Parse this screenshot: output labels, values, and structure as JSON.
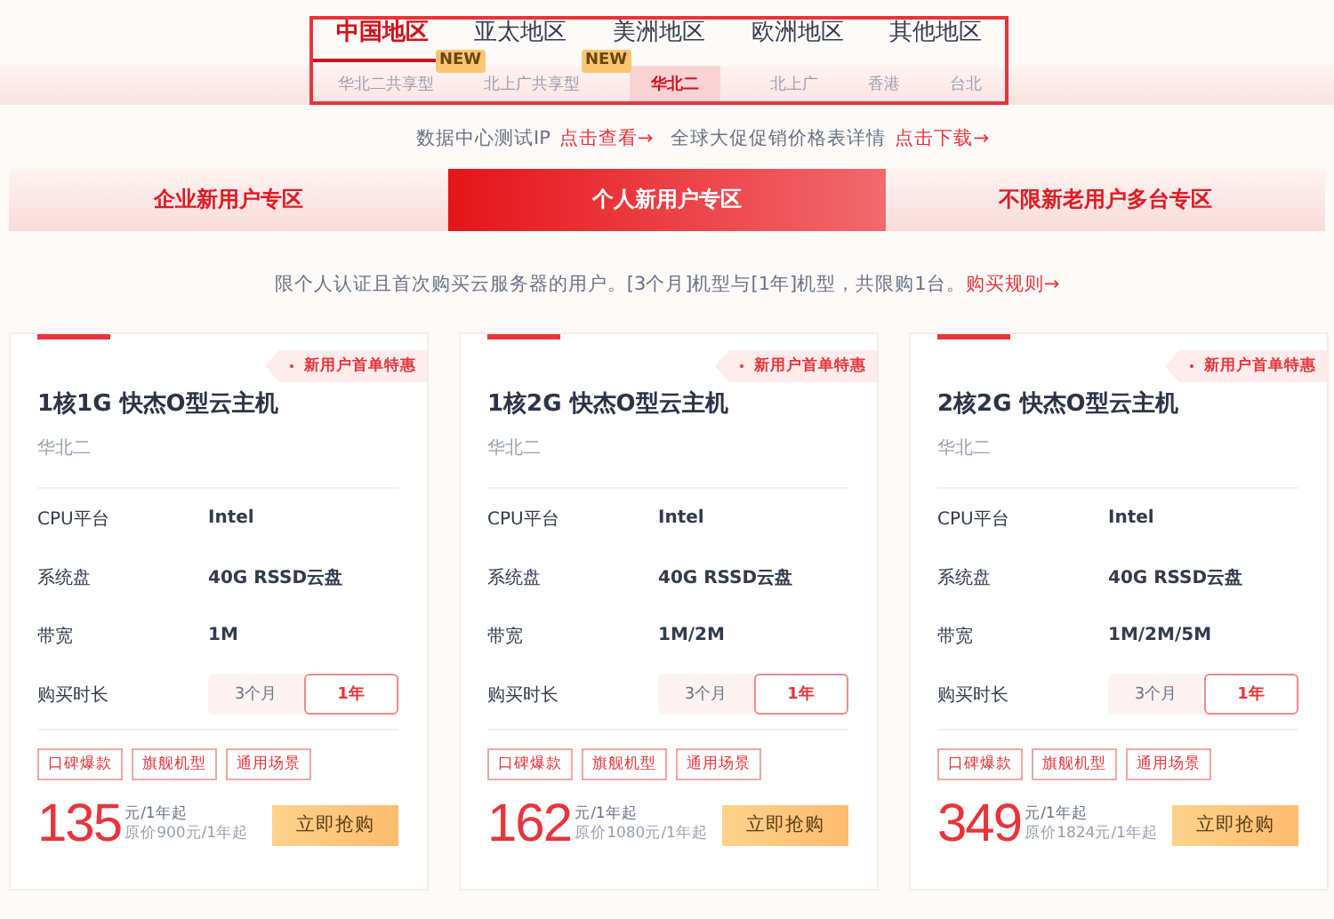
{
  "regions": [
    {
      "label": "中国地区",
      "selected": true
    },
    {
      "label": "亚太地区",
      "selected": false
    },
    {
      "label": "美洲地区",
      "selected": false
    },
    {
      "label": "欧洲地区",
      "selected": false
    },
    {
      "label": "其他地区",
      "selected": false
    }
  ],
  "subregions": [
    {
      "label": "华北二共享型",
      "selected": false
    },
    {
      "label": "北上广共享型",
      "selected": false,
      "badge": "NEW"
    },
    {
      "label": "华北二",
      "selected": true,
      "badge": "NEW"
    },
    {
      "label": "北上广",
      "selected": false
    },
    {
      "label": "香港",
      "selected": false
    },
    {
      "label": "台北",
      "selected": false
    }
  ],
  "links": [
    {
      "text": "数据中心测试IP",
      "link": "点击查看→"
    },
    {
      "text": "全球大促促销价格表详情",
      "link": "点击下载→"
    }
  ],
  "zones": [
    {
      "label": "企业新用户专区",
      "selected": false
    },
    {
      "label": "个人新用户专区",
      "selected": true
    },
    {
      "label": "不限新老用户多台专区",
      "selected": false
    }
  ],
  "notice": {
    "text": "限个人认证且首次购买云服务器的用户。[3个月]机型与[1年]机型，共限购1台。",
    "link": "购买规则→"
  },
  "cards": [
    {
      "promo": "新用户首单特惠",
      "title": "1核1G 快杰O型云主机",
      "region": "华北二",
      "specs": [
        {
          "label": "CPU平台",
          "value": "Intel"
        },
        {
          "label": "系统盘",
          "value": "40G RSSD云盘"
        },
        {
          "label": "带宽",
          "value": "1M"
        }
      ],
      "duration_label": "购买时长",
      "durations": [
        {
          "label": "3个月",
          "selected": false
        },
        {
          "label": "1年",
          "selected": true
        }
      ],
      "tags": [
        "口碑爆款",
        "旗舰机型",
        "通用场景"
      ],
      "price": "135",
      "unit": "元/1年起",
      "original": "原价900元/1年起",
      "button": "立即抢购"
    },
    {
      "promo": "新用户首单特惠",
      "title": "1核2G 快杰O型云主机",
      "region": "华北二",
      "specs": [
        {
          "label": "CPU平台",
          "value": "Intel"
        },
        {
          "label": "系统盘",
          "value": "40G RSSD云盘"
        },
        {
          "label": "带宽",
          "value": "1M/2M"
        }
      ],
      "duration_label": "购买时长",
      "durations": [
        {
          "label": "3个月",
          "selected": false
        },
        {
          "label": "1年",
          "selected": true
        }
      ],
      "tags": [
        "口碑爆款",
        "旗舰机型",
        "通用场景"
      ],
      "price": "162",
      "unit": "元/1年起",
      "original": "原价1080元/1年起",
      "button": "立即抢购"
    },
    {
      "promo": "新用户首单特惠",
      "title": "2核2G 快杰O型云主机",
      "region": "华北二",
      "specs": [
        {
          "label": "CPU平台",
          "value": "Intel"
        },
        {
          "label": "系统盘",
          "value": "40G RSSD云盘"
        },
        {
          "label": "带宽",
          "value": "1M/2M/5M"
        }
      ],
      "duration_label": "购买时长",
      "durations": [
        {
          "label": "3个月",
          "selected": false
        },
        {
          "label": "1年",
          "selected": true
        }
      ],
      "tags": [
        "口碑爆款",
        "旗舰机型",
        "通用场景"
      ],
      "price": "349",
      "unit": "元/1年起",
      "original": "原价1824元/1年起",
      "button": "立即抢购"
    }
  ]
}
